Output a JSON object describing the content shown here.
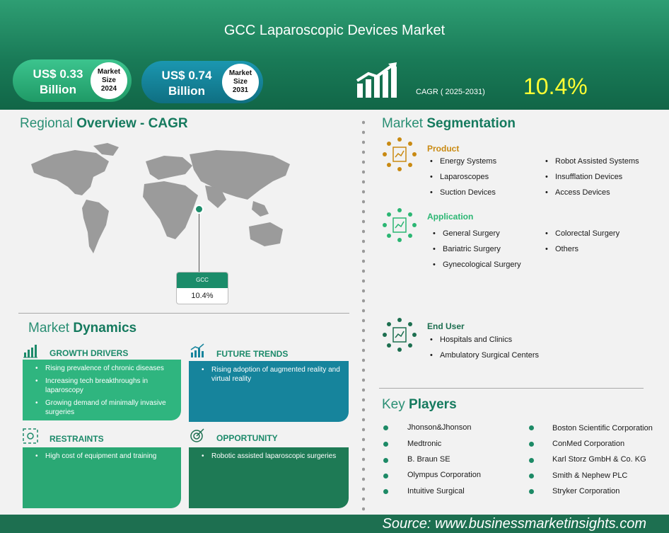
{
  "header": {
    "title": "GCC Laparoscopic Devices Market",
    "market_2024": {
      "amount_line1": "US$ 0.33",
      "amount_line2": "Billion",
      "label_line1": "Market",
      "label_line2": "Size",
      "label_line3": "2024"
    },
    "market_2031": {
      "amount_line1": "US$ 0.74",
      "amount_line2": "Billion",
      "label_line1": "Market",
      "label_line2": "Size",
      "label_line3": "2031"
    },
    "cagr_label": "CAGR ( 2025-2031)",
    "cagr_value": "10.4%"
  },
  "regional": {
    "title_light": "Regional",
    "title_bold": "Overview - CAGR",
    "region_name": "GCC",
    "region_value": "10.4%"
  },
  "dynamics": {
    "title_light": "Market",
    "title_bold": "Dynamics",
    "growth_drivers": {
      "heading": "GROWTH DRIVERS",
      "items": [
        "Rising prevalence of chronic diseases",
        "Increasing tech breakthroughs in laparoscopy",
        "Growing demand of minimally invasive surgeries"
      ]
    },
    "future_trends": {
      "heading": "FUTURE TRENDS",
      "items": [
        "Rising adoption of augmented reality and virtual reality"
      ]
    },
    "restraints": {
      "heading": "RESTRAINTS",
      "items": [
        "High cost of equipment and training"
      ]
    },
    "opportunity": {
      "heading": "OPPORTUNITY",
      "items": [
        "Robotic assisted laparoscopic surgeries"
      ]
    }
  },
  "segmentation": {
    "title_light": "Market",
    "title_bold": "Segmentation",
    "product": {
      "heading": "Product",
      "items": [
        "Energy Systems",
        "Laparoscopes",
        "Suction Devices",
        "Robot Assisted Systems",
        "Insufflation Devices",
        "Access Devices"
      ]
    },
    "application": {
      "heading": "Application",
      "items": [
        "General Surgery",
        "Bariatric Surgery",
        "Gynecological Surgery",
        "Colorectal Surgery",
        "Others"
      ]
    },
    "end_user": {
      "heading": "End User",
      "items": [
        "Hospitals and Clinics",
        "Ambulatory Surgical Centers"
      ]
    }
  },
  "key_players": {
    "title_light": "Key",
    "title_bold": "Players",
    "items": [
      "Jhonson&Jhonson",
      "Medtronic",
      "B. Braun SE",
      "Olympus Corporation",
      "Intuitive Surgical",
      "Boston Scientific Corporation",
      "ConMed Corporation",
      "Karl Storz GmbH & Co. KG",
      "Smith & Nephew PLC",
      "Stryker Corporation"
    ]
  },
  "footer": {
    "source": "Source:  www.businessmarketinsights.com"
  },
  "colors": {
    "primary": "#1b8c6a",
    "accent_yellow": "#ffff33",
    "teal": "#16849c",
    "product": "#c98a12",
    "application": "#2bb673",
    "end_user": "#1d6f50"
  }
}
